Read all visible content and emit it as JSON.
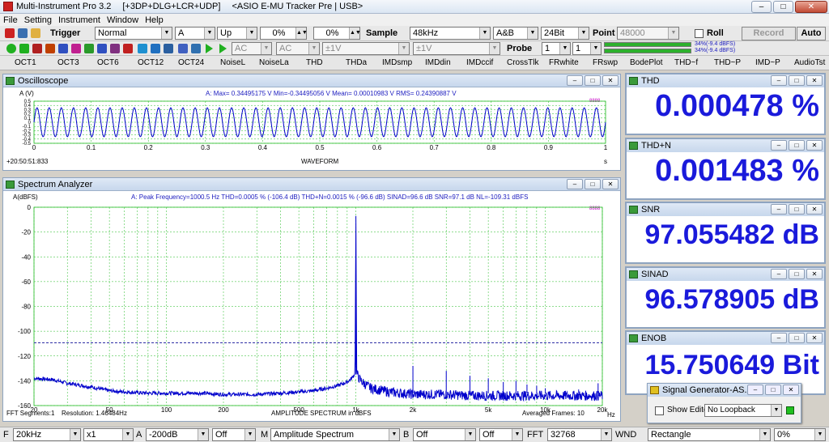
{
  "window": {
    "title": "Multi-Instrument Pro 3.2",
    "modules": "[+3DP+DLG+LCR+UDP]",
    "device": "<ASIO E-MU Tracker Pre | USB>",
    "btn_min": "–",
    "btn_max": "□",
    "btn_close": "✕"
  },
  "menu": [
    "File",
    "Setting",
    "Instrument",
    "Window",
    "Help"
  ],
  "toolbar1": {
    "trigger_label": "Trigger",
    "trigger_mode": "Normal",
    "trigger_channel": "A",
    "trigger_edge": "Up",
    "level1": "0%",
    "level2": "0%",
    "sample_label": "Sample",
    "sample_rate": "48kHz",
    "channels": "A&B",
    "bit_depth": "24Bit",
    "point_label": "Point",
    "point_value": "48000",
    "roll_label": "Roll",
    "record_label": "Record",
    "auto_label": "Auto",
    "level_a": "34%(-9.4 dBFS)",
    "level_b": "34%(-9.4 dBFS)"
  },
  "toolbar2": {
    "coupling_a": "AC",
    "coupling_b": "AC",
    "range_a": "±1V",
    "range_b": "±1V",
    "probe_label": "Probe",
    "probe_a": "1",
    "probe_b": "1"
  },
  "tabs": [
    "OCT1",
    "OCT3",
    "OCT6",
    "OCT12",
    "OCT24",
    "NoiseL",
    "NoiseLa",
    "THD",
    "THDa",
    "IMDsmp",
    "IMDdin",
    "IMDccif",
    "CrossTlk",
    "FRwhite",
    "FRswp",
    "BodePlot",
    "THD~f",
    "THD~P",
    "IMD~P",
    "AudioTst"
  ],
  "oscilloscope": {
    "title": "Oscilloscope",
    "ylabel": "A (V)",
    "stats": "A: Max= 0.34495175 V  Min=-0.34495056 V  Mean= 0.00010983 V  RMS= 0.24390887 V",
    "timestamp": "+20:50:51:833",
    "xlabel": "WAVEFORM",
    "xunit": "s",
    "marker": "8888"
  },
  "spectrum": {
    "title": "Spectrum Analyzer",
    "ylabel": "A(dBFS)",
    "stats": "A: Peak Frequency=1000.5 Hz  THD=0.0005 % (-106.4 dB)  THD+N=0.0015 % (-96.6 dB)  SINAD=96.6 dB  SNR=97.1 dB  NL=-109.31 dBFS",
    "xlabel": "AMPLITUDE SPECTRUM in dBFS",
    "segments": "FFT Segments:1",
    "resolution": "Resolution: 1.46484Hz",
    "frames": "Averaged Frames: 10",
    "xunit": "Hz",
    "marker": "8888"
  },
  "meters": [
    {
      "name": "THD",
      "value": "0.000478 %"
    },
    {
      "name": "THD+N",
      "value": "0.001483 %"
    },
    {
      "name": "SNR",
      "value": "97.055482 dB"
    },
    {
      "name": "SINAD",
      "value": "96.578905 dB"
    },
    {
      "name": "ENOB",
      "value": "15.750649 Bit"
    }
  ],
  "siggen": {
    "title": "Signal Generator-AS...",
    "show_editor": "Show Editor",
    "loopback": "No Loopback"
  },
  "statusbar": {
    "f_label": "F",
    "f_value": "20kHz",
    "zoom": "x1",
    "a_label": "A",
    "a_value": "-200dB",
    "off1": "Off",
    "m_label": "M",
    "mode": "Amplitude Spectrum",
    "b_label": "B",
    "off2": "Off",
    "off3": "Off",
    "fft_label": "FFT",
    "fft_size": "32768",
    "wnd_label": "WND",
    "window_fn": "Rectangle",
    "overlap": "0%"
  },
  "chart_data": [
    {
      "type": "line",
      "title": "",
      "xlabel": "WAVEFORM",
      "ylabel": "A (V)",
      "x_unit": "s",
      "xlim": [
        0,
        1
      ],
      "ylim": [
        -0.5,
        0.5
      ],
      "x_ticks": [
        "0",
        "0.1",
        "0.2",
        "0.3",
        "0.4",
        "0.5",
        "0.6",
        "0.7",
        "0.8",
        "0.9",
        "1"
      ],
      "y_ticks": [
        "0.5",
        "0.4",
        "0.3",
        "0.2",
        "0.1",
        "0",
        "-0.1",
        "-0.2",
        "-0.3",
        "-0.4",
        "-0.5"
      ],
      "series": [
        {
          "amplitude": 0.34495,
          "cycles_shown": 47,
          "color": "#0000cc"
        }
      ]
    },
    {
      "type": "line",
      "title": "",
      "xlabel": "AMPLITUDE SPECTRUM in dBFS",
      "ylabel": "A(dBFS)",
      "x_scale": "log",
      "xlim": [
        20,
        20000
      ],
      "ylim": [
        -160,
        0
      ],
      "x_ticks": [
        "20",
        "50",
        "100",
        "200",
        "500",
        "1k",
        "2k",
        "5k",
        "10k",
        "20k"
      ],
      "y_ticks": [
        "0",
        "-20",
        "-40",
        "-60",
        "-80",
        "-100",
        "-120",
        "-140",
        "-160"
      ],
      "noise_level_line": -109.31,
      "series": [
        {
          "color": "#0000cc",
          "x": [
            20,
            25,
            30,
            40,
            50,
            60,
            80,
            100,
            150,
            200,
            300,
            400,
            500,
            600,
            700,
            800,
            900,
            950,
            990,
            1000.5,
            1010,
            1050,
            1100,
            1200,
            1500,
            2000,
            3000,
            4000,
            5000,
            7000,
            10000,
            15000,
            20000
          ],
          "y": [
            -138,
            -139,
            -142,
            -145,
            -148,
            -149,
            -150,
            -150,
            -150,
            -151,
            -151,
            -150,
            -149,
            -148,
            -146,
            -144,
            -141,
            -138,
            -134,
            -7,
            -134,
            -139,
            -142,
            -146,
            -149,
            -151,
            -151,
            -152,
            -152,
            -152,
            -152,
            -152,
            -152
          ]
        }
      ],
      "harmonics": [
        {
          "x": 2001,
          "y": -128
        },
        {
          "x": 3001,
          "y": -132
        },
        {
          "x": 4002,
          "y": -136
        },
        {
          "x": 5002,
          "y": -138
        },
        {
          "x": 6003,
          "y": -141
        },
        {
          "x": 7003,
          "y": -140
        },
        {
          "x": 8004,
          "y": -143
        },
        {
          "x": 9004,
          "y": -144
        },
        {
          "x": 10005,
          "y": -146
        },
        {
          "x": 15000,
          "y": -147
        },
        {
          "x": 19000,
          "y": -142
        }
      ]
    }
  ]
}
